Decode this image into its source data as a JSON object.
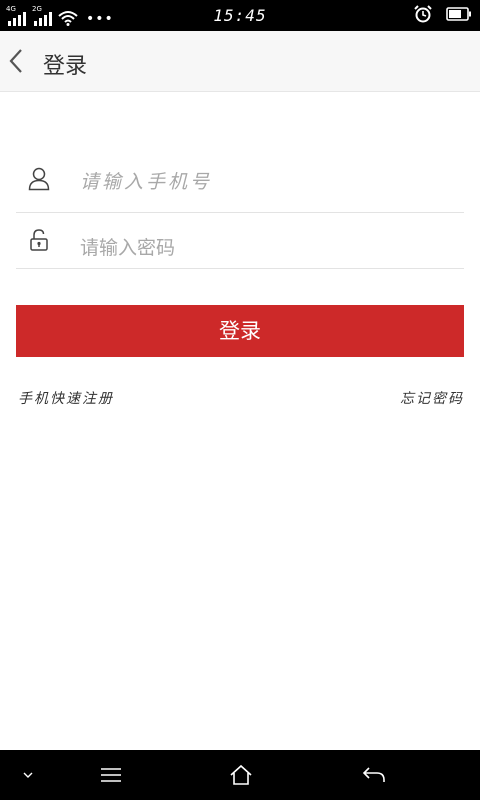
{
  "status_bar": {
    "network1": "4G",
    "network2": "2G",
    "more": "•••",
    "time": "15:45",
    "icons": [
      "signal-icon",
      "wifi-icon",
      "alarm-icon",
      "battery-icon"
    ]
  },
  "header": {
    "title": "登录",
    "back_icon": "chevron-left-icon"
  },
  "form": {
    "phone_placeholder": "请输入手机号",
    "password_placeholder": "请输入密码",
    "login_button": "登录",
    "register_link": "手机快速注册",
    "forgot_link": "忘记密码"
  },
  "colors": {
    "accent": "#cd2929",
    "header_bg": "#f7f7f7",
    "placeholder": "#a8a8a8"
  },
  "nav_bar": {
    "icons": [
      "chevron-down-icon",
      "menu-icon",
      "home-icon",
      "back-arrow-icon"
    ]
  }
}
